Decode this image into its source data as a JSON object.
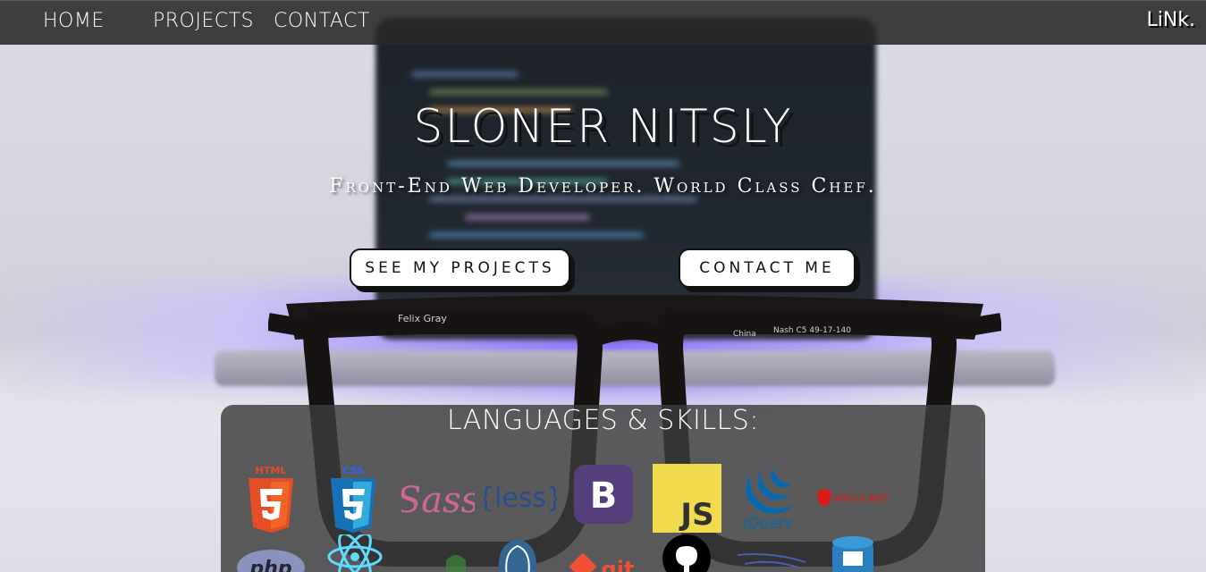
{
  "nav": {
    "links": [
      {
        "label": "HOME"
      },
      {
        "label": "PROJECTS"
      },
      {
        "label": "CONTACT"
      }
    ],
    "logo": "LiNk."
  },
  "hero": {
    "title": "SLONER NITSLY",
    "subtitle": "Front-End Web Developer. World Class Chef.",
    "buttons": {
      "projects": "SEE MY PROJECTS",
      "contact": "CONTACT ME"
    }
  },
  "skills": {
    "title": "LANGUAGES & SKILLS:",
    "icons": {
      "html": "HTML",
      "css": "CSS",
      "sass": "Sass",
      "less": "{less}",
      "bootstrap": "B",
      "js": "JS",
      "jquery": "jQuery",
      "angular": "ANGULARJS",
      "php": "php",
      "git": "git"
    }
  },
  "colors": {
    "navbar": "#282828",
    "panel": "#3c3c3c",
    "html": "#e44d26",
    "css": "#2965f1",
    "sass": "#cd6799",
    "less": "#1d365d",
    "bootstrap": "#563d7c",
    "js": "#f0db4f",
    "jquery": "#0769ad",
    "angular": "#dd1b16",
    "react": "#61dafb",
    "git": "#f05032"
  },
  "glasses_label": {
    "brand": "Felix Gray",
    "origin": "China",
    "model": "Nash C5 49-17-140"
  }
}
